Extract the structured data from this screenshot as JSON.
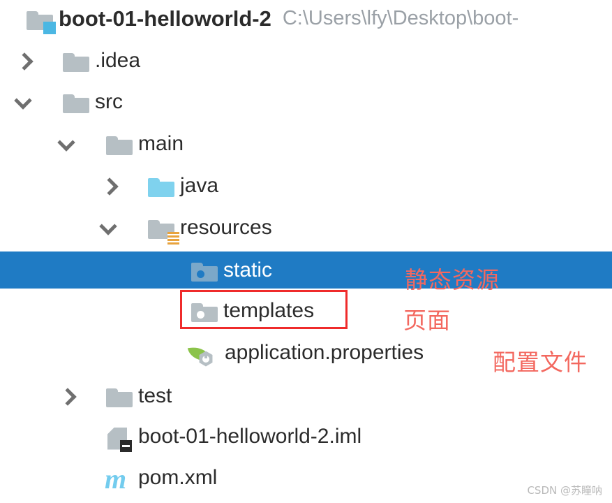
{
  "window": {
    "kind": "ide-project-tool-window",
    "background": "#ffffff",
    "selection_color": "#1f7bc4",
    "annotation_color": "#f3685f",
    "highlight_border_color": "#ef2b2b"
  },
  "project": {
    "name": "boot-01-helloworld-2",
    "path": "C:\\Users\\lfy\\Desktop\\boot-"
  },
  "tree": {
    "rows": [
      {
        "label": "boot-01-helloworld-2",
        "icon": "project-folder-icon",
        "arrow": "none",
        "depth": 0,
        "selected": false
      },
      {
        "label": ".idea",
        "icon": "folder-icon",
        "arrow": "chevron-right-icon",
        "depth": 1,
        "selected": false
      },
      {
        "label": "src",
        "icon": "folder-icon",
        "arrow": "chevron-down-icon",
        "depth": 1,
        "selected": false
      },
      {
        "label": "main",
        "icon": "folder-icon",
        "arrow": "chevron-down-icon",
        "depth": 2,
        "selected": false
      },
      {
        "label": "java",
        "icon": "source-root-folder-icon",
        "arrow": "chevron-right-icon",
        "depth": 3,
        "selected": false
      },
      {
        "label": "resources",
        "icon": "resources-root-folder-icon",
        "arrow": "chevron-down-icon",
        "depth": 3,
        "selected": false
      },
      {
        "label": "static",
        "icon": "package-folder-icon",
        "arrow": "none",
        "depth": 4,
        "selected": true
      },
      {
        "label": "templates",
        "icon": "package-folder-icon",
        "arrow": "none",
        "depth": 4,
        "selected": false
      },
      {
        "label": "application.properties",
        "icon": "spring-boot-config-icon",
        "arrow": "none",
        "depth": 4,
        "selected": false
      },
      {
        "label": "test",
        "icon": "folder-icon",
        "arrow": "chevron-right-icon",
        "depth": 2,
        "selected": false
      },
      {
        "label": "boot-01-helloworld-2.iml",
        "icon": "iml-module-file-icon",
        "arrow": "none",
        "depth": 2,
        "selected": false
      },
      {
        "label": "pom.xml",
        "icon": "maven-pom-icon",
        "arrow": "none",
        "depth": 2,
        "selected": false
      }
    ]
  },
  "annotations": [
    {
      "id": "static",
      "text": "静态资源"
    },
    {
      "id": "templates",
      "text": "页面"
    },
    {
      "id": "config",
      "text": "配置文件"
    }
  ],
  "watermark": {
    "text": "CSDN @苏瞳呐"
  }
}
